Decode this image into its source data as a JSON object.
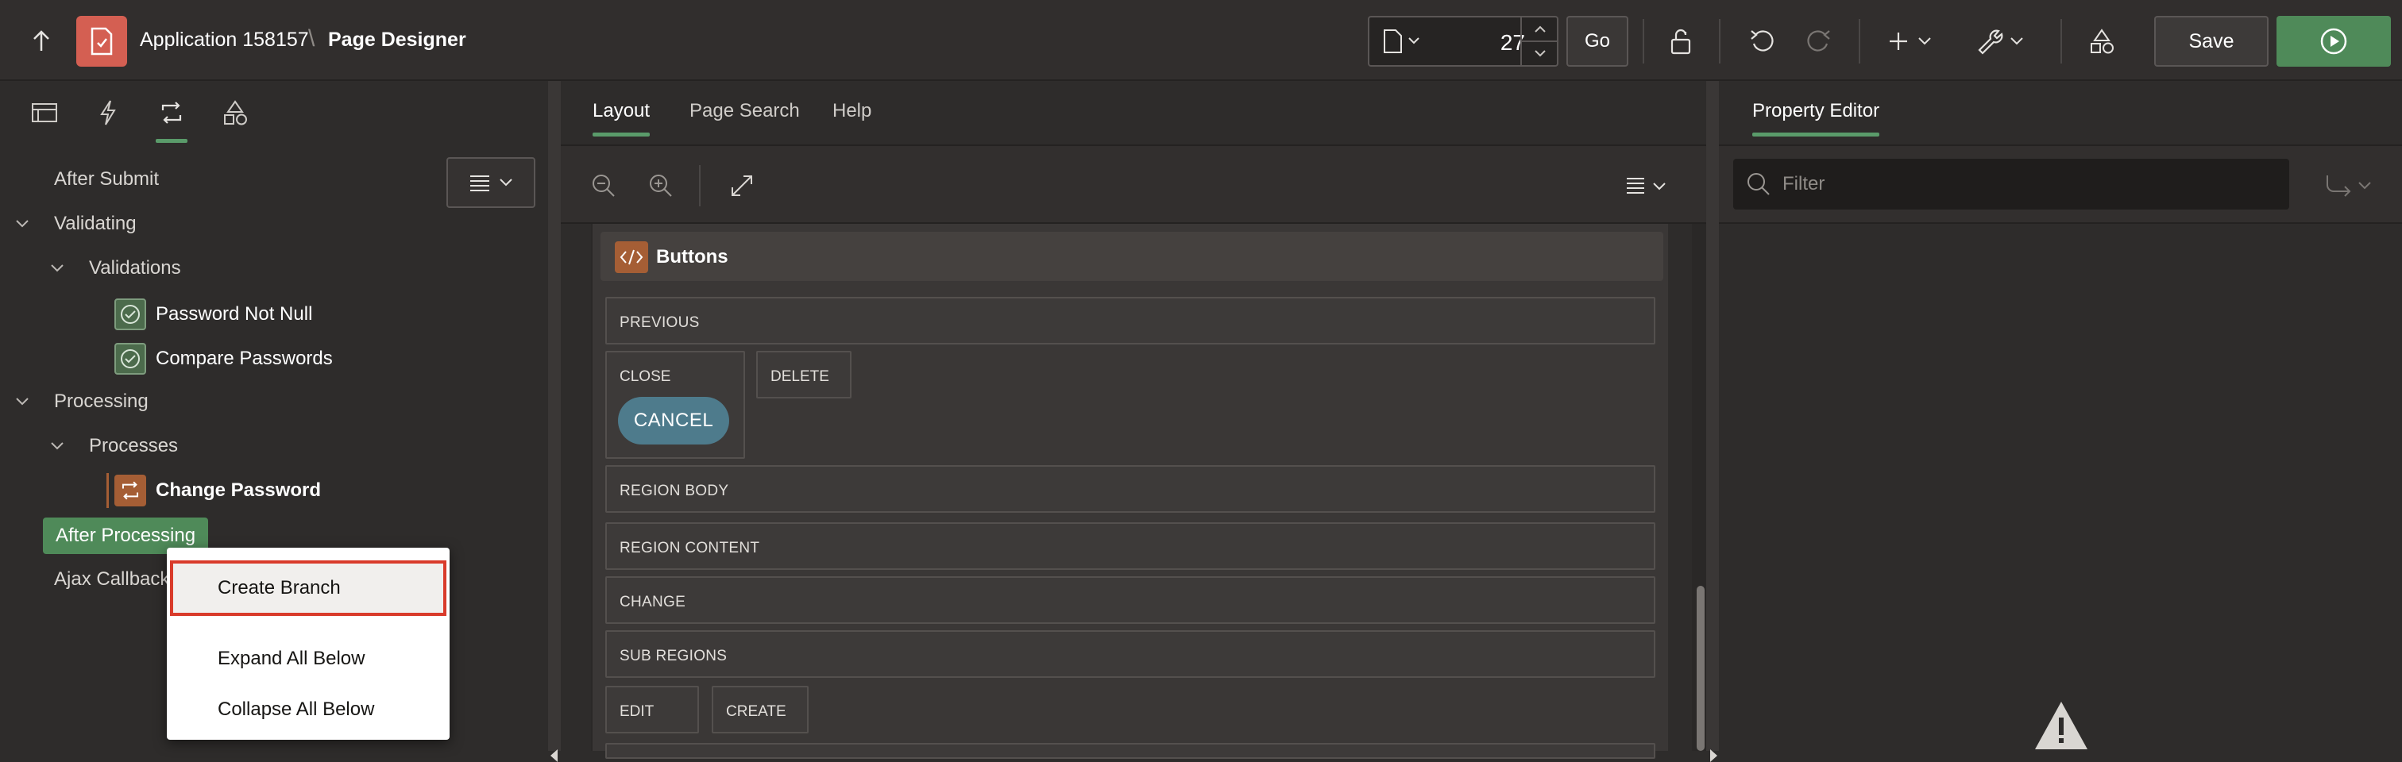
{
  "header": {
    "app_title": "Application 158157",
    "separator": "\\",
    "page_title": "Page Designer",
    "page_number": "27",
    "go_label": "Go",
    "save_label": "Save"
  },
  "left": {
    "tree": {
      "after_submit": "After Submit",
      "validating": "Validating",
      "validations": "Validations",
      "password_not_null": "Password Not Null",
      "compare_passwords": "Compare Passwords",
      "processing": "Processing",
      "processes": "Processes",
      "change_password": "Change Password",
      "after_processing": "After Processing",
      "ajax_callback": "Ajax Callback"
    },
    "context_menu": {
      "create_branch": "Create Branch",
      "expand_all": "Expand All Below",
      "collapse_all": "Collapse All Below"
    }
  },
  "center": {
    "tabs": [
      "Layout",
      "Page Search",
      "Help"
    ],
    "region_title": "Buttons",
    "slots": {
      "previous": "PREVIOUS",
      "close": "CLOSE",
      "cancel": "CANCEL",
      "delete": "DELETE",
      "region_body": "REGION BODY",
      "region_content": "REGION CONTENT",
      "change": "CHANGE",
      "sub_regions": "SUB REGIONS",
      "edit": "EDIT",
      "create": "CREATE"
    }
  },
  "right": {
    "tab": "Property Editor",
    "filter_placeholder": "Filter"
  },
  "colors": {
    "accent_green": "#4f8a59",
    "app_icon_red": "#d45f52",
    "cancel_button": "#4e7b8c",
    "highlight_border": "#d93b2b"
  }
}
